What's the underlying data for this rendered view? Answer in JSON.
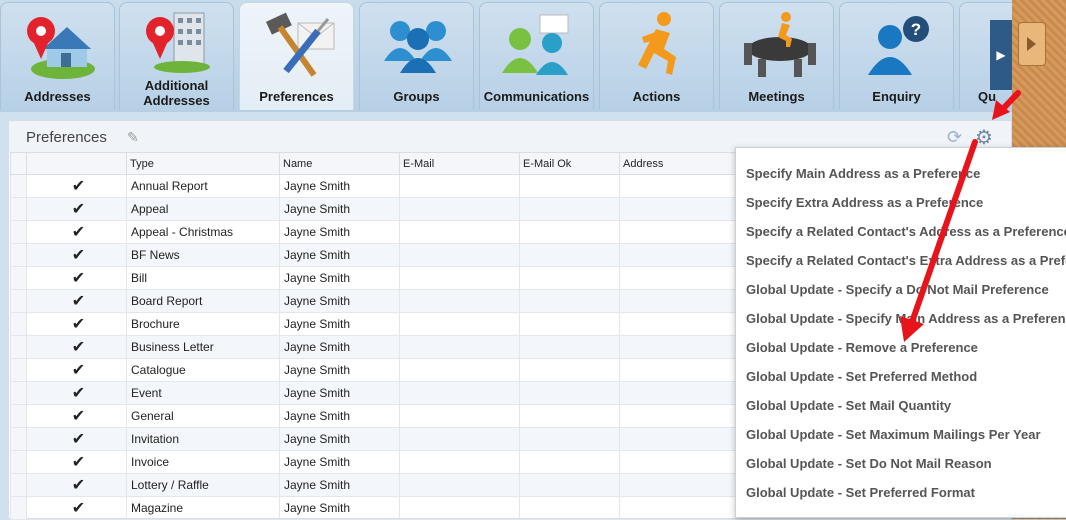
{
  "tabs": [
    {
      "label": "Addresses",
      "icon": "address-house-pin-icon"
    },
    {
      "label": "Additional Addresses",
      "icon": "building-pin-icon"
    },
    {
      "label": "Preferences",
      "icon": "tools-icon"
    },
    {
      "label": "Groups",
      "icon": "people-group-icon"
    },
    {
      "label": "Communications",
      "icon": "communications-people-icon"
    },
    {
      "label": "Actions",
      "icon": "running-person-icon"
    },
    {
      "label": "Meetings",
      "icon": "meeting-table-icon"
    },
    {
      "label": "Enquiry",
      "icon": "question-person-icon"
    },
    {
      "label": "Qu",
      "icon": "truncated-tab-icon"
    }
  ],
  "panel": {
    "title": "Preferences"
  },
  "table": {
    "columns": [
      "Type",
      "Name",
      "E-Mail",
      "E-Mail Ok",
      "Address"
    ],
    "rows": [
      {
        "type": "Annual Report",
        "name": "Jayne Smith"
      },
      {
        "type": "Appeal",
        "name": "Jayne Smith"
      },
      {
        "type": "Appeal - Christmas",
        "name": "Jayne Smith"
      },
      {
        "type": "BF News",
        "name": "Jayne Smith"
      },
      {
        "type": "Bill",
        "name": "Jayne Smith"
      },
      {
        "type": "Board Report",
        "name": "Jayne Smith"
      },
      {
        "type": "Brochure",
        "name": "Jayne Smith"
      },
      {
        "type": "Business Letter",
        "name": "Jayne Smith"
      },
      {
        "type": "Catalogue",
        "name": "Jayne Smith"
      },
      {
        "type": "Event",
        "name": "Jayne Smith"
      },
      {
        "type": "General",
        "name": "Jayne Smith"
      },
      {
        "type": "Invitation",
        "name": "Jayne Smith"
      },
      {
        "type": "Invoice",
        "name": "Jayne Smith"
      },
      {
        "type": "Lottery / Raffle",
        "name": "Jayne Smith"
      },
      {
        "type": "Magazine",
        "name": "Jayne Smith"
      }
    ]
  },
  "menu": {
    "items": [
      "Specify Main Address as a Preference",
      "Specify Extra Address as a Preference",
      "Specify a Related Contact's Address as a Preference",
      "Specify a Related Contact's Extra Address as a Preference",
      "Global Update - Specify a Do Not Mail Preference",
      "Global Update - Specify Main Address as a Preference",
      "Global Update - Remove a Preference",
      "Global Update - Set Preferred Method",
      "Global Update - Set Mail Quantity",
      "Global Update - Set Maximum Mailings Per Year",
      "Global Update - Set Do Not Mail Reason",
      "Global Update - Set Preferred Format"
    ]
  },
  "colors": {
    "annotation_arrow": "#e8141b",
    "menu_text": "#555555",
    "header_bg": "#f0f3f7"
  }
}
